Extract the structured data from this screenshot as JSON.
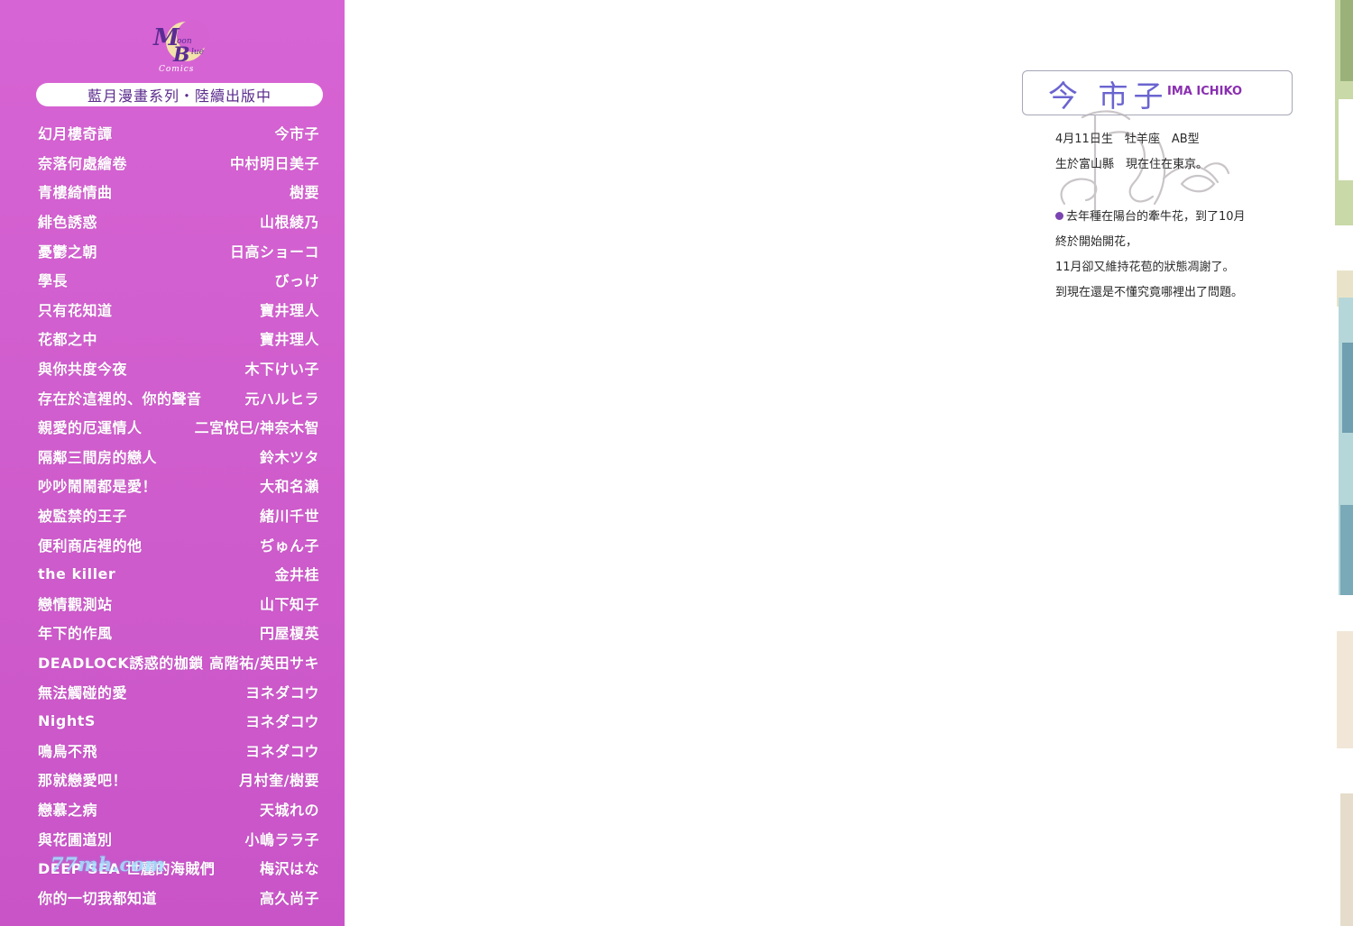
{
  "logo": {
    "icon": "moon-blue-comics-logo",
    "text": "Moon Blue Comics"
  },
  "banner": {
    "text": "藍月漫畫系列・陸續出版中"
  },
  "books": [
    {
      "title": "幻月樓奇譚",
      "author": "今市子"
    },
    {
      "title": "奈落何處繪卷",
      "author": "中村明日美子"
    },
    {
      "title": "青樓綺情曲",
      "author": "樹要"
    },
    {
      "title": "緋色誘惑",
      "author": "山根綾乃"
    },
    {
      "title": "憂鬱之朝",
      "author": "日高ショーコ"
    },
    {
      "title": "學長",
      "author": "びっけ"
    },
    {
      "title": "只有花知道",
      "author": "寶井理人"
    },
    {
      "title": "花都之中",
      "author": "寶井理人"
    },
    {
      "title": "與你共度今夜",
      "author": "木下けい子"
    },
    {
      "title": "存在於這裡的、你的聲音",
      "author": "元ハルヒラ"
    },
    {
      "title": "親愛的厄運情人",
      "author": "二宮悅巳/神奈木智"
    },
    {
      "title": "隔鄰三間房的戀人",
      "author": "鈴木ツタ"
    },
    {
      "title": "吵吵鬧鬧都是愛！",
      "author": "大和名瀨"
    },
    {
      "title": "被監禁的王子",
      "author": "緒川千世"
    },
    {
      "title": "便利商店裡的他",
      "author": "ぢゅん子"
    },
    {
      "title": "the killer",
      "author": "金井桂"
    },
    {
      "title": "戀情觀測站",
      "author": "山下知子"
    },
    {
      "title": "年下的作風",
      "author": "円屋榎英"
    },
    {
      "title": "DEADLOCK誘惑的枷鎖",
      "author": "高階祐/英田サキ"
    },
    {
      "title": "無法觸碰的愛",
      "author": "ヨネダコウ"
    },
    {
      "title": "NightS",
      "author": "ヨネダコウ"
    },
    {
      "title": "鳴鳥不飛",
      "author": "ヨネダコウ"
    },
    {
      "title": "那就戀愛吧！",
      "author": "月村奎/樹要"
    },
    {
      "title": "戀慕之病",
      "author": "天城れの"
    },
    {
      "title": "與花圃道別",
      "author": "小嶋ララ子"
    },
    {
      "title": "DEEP SEA 世麗的海賊們",
      "author": "梅沢はな"
    },
    {
      "title": "你的一切我都知道",
      "author": "高久尚子"
    }
  ],
  "watermark": "77mh.com",
  "author_profile": {
    "name_jp": "今 市子",
    "name_en": "IMA ICHIKO",
    "signature_icon": "ichiko-signature",
    "birth": "4月11日生　牡羊座　AB型",
    "residence": "生於富山縣　現在住在東京。",
    "note": [
      "去年種在陽台的牽牛花，到了10月",
      "終於開始開花，",
      "11月卻又維持花苞的狀態凋謝了。",
      "到現在還是不懂究竟哪裡出了問題。"
    ]
  },
  "colors": {
    "panel": "#d060cf",
    "name": "#6a64d0",
    "bullet": "#7a44b0"
  }
}
